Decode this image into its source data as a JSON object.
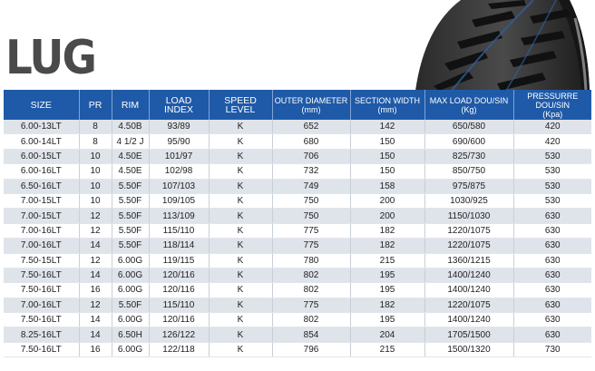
{
  "title": "LUG",
  "columns": [
    {
      "label": "SIZE",
      "unit": ""
    },
    {
      "label": "PR",
      "unit": ""
    },
    {
      "label": "RIM",
      "unit": ""
    },
    {
      "label": "LOAD INDEX",
      "unit": ""
    },
    {
      "label": "SPEED LEVEL",
      "unit": ""
    },
    {
      "label": "OUTER DIAMETER",
      "unit": "(mm)"
    },
    {
      "label": "SECTION WIDTH",
      "unit": "(mm)"
    },
    {
      "label": "MAX LOAD DOU/SIN",
      "unit": "(Kg)"
    },
    {
      "label": "PRESSURRE DOU/SIN",
      "unit": "(Kpa)"
    }
  ],
  "rows": [
    [
      "6.00-13LT",
      "8",
      "4.50B",
      "93/89",
      "K",
      "652",
      "142",
      "650/580",
      "420"
    ],
    [
      "6.00-14LT",
      "8",
      "4 1/2 J",
      "95/90",
      "K",
      "680",
      "150",
      "690/600",
      "420"
    ],
    [
      "6.00-15LT",
      "10",
      "4.50E",
      "101/97",
      "K",
      "706",
      "150",
      "825/730",
      "530"
    ],
    [
      "6.00-16LT",
      "10",
      "4.50E",
      "102/98",
      "K",
      "732",
      "150",
      "850/750",
      "530"
    ],
    [
      "6.50-16LT",
      "10",
      "5.50F",
      "107/103",
      "K",
      "749",
      "158",
      "975/875",
      "530"
    ],
    [
      "7.00-15LT",
      "10",
      "5.50F",
      "109/105",
      "K",
      "750",
      "200",
      "1030/925",
      "530"
    ],
    [
      "7.00-15LT",
      "12",
      "5.50F",
      "113/109",
      "K",
      "750",
      "200",
      "1150/1030",
      "630"
    ],
    [
      "7.00-16LT",
      "12",
      "5.50F",
      "115/110",
      "K",
      "775",
      "182",
      "1220/1075",
      "630"
    ],
    [
      "7.00-16LT",
      "14",
      "5.50F",
      "118/114",
      "K",
      "775",
      "182",
      "1220/1075",
      "630"
    ],
    [
      "7.50-15LT",
      "12",
      "6.00G",
      "119/115",
      "K",
      "780",
      "215",
      "1360/1215",
      "630"
    ],
    [
      "7.50-16LT",
      "14",
      "6.00G",
      "120/116",
      "K",
      "802",
      "195",
      "1400/1240",
      "630"
    ],
    [
      "7.50-16LT",
      "16",
      "6.00G",
      "120/116",
      "K",
      "802",
      "195",
      "1400/1240",
      "630"
    ],
    [
      "7.00-16LT",
      "12",
      "5.50F",
      "115/110",
      "K",
      "775",
      "182",
      "1220/1075",
      "630"
    ],
    [
      "7.50-16LT",
      "14",
      "6.00G",
      "120/116",
      "K",
      "802",
      "195",
      "1400/1240",
      "630"
    ],
    [
      "8.25-16LT",
      "14",
      "6.50H",
      "126/122",
      "K",
      "854",
      "204",
      "1705/1500",
      "630"
    ],
    [
      "7.50-16LT",
      "16",
      "6.00G",
      "122/118",
      "K",
      "796",
      "215",
      "1500/1320",
      "730"
    ]
  ],
  "colors": {
    "header_bg": "#1f5aa8",
    "row_alt_bg": "#dfe3ea",
    "title": "#4a4a4a"
  },
  "image": {
    "icon": "tire-tread-icon"
  }
}
